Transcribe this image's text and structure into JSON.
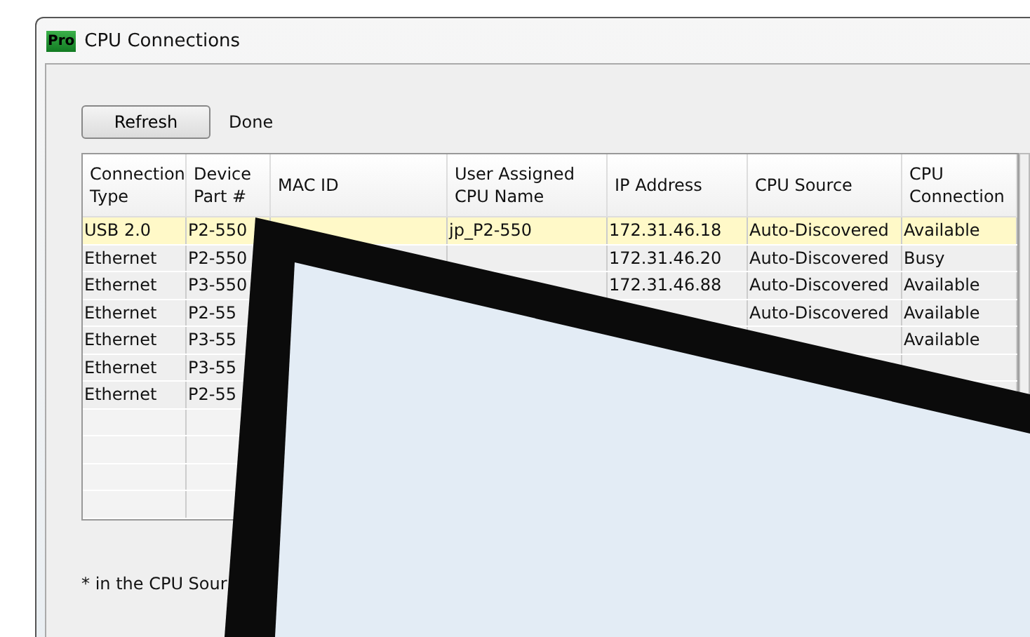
{
  "window": {
    "logo": "Pro",
    "title": "CPU Connections"
  },
  "toolbar": {
    "button": "Refresh",
    "status": "Done"
  },
  "table": {
    "columns": [
      "Connection Type",
      "Device Part #",
      "MAC ID",
      "User Assigned CPU Name",
      "IP Address",
      "CPU Source",
      "CPU Connection"
    ],
    "rows": [
      {
        "selected": true,
        "cells": [
          "USB 2.0",
          "P2-550",
          "",
          "jp_P2-550",
          "172.31.46.18",
          "Auto-Discovered",
          "Available"
        ]
      },
      {
        "selected": false,
        "cells": [
          "Ethernet",
          "P2-550",
          "",
          "",
          "172.31.46.20",
          "Auto-Discovered",
          "Busy"
        ]
      },
      {
        "selected": false,
        "cells": [
          "Ethernet",
          "P3-550",
          "",
          "",
          "172.31.46.88",
          "Auto-Discovered",
          "Available"
        ]
      },
      {
        "selected": false,
        "cells": [
          "Ethernet",
          "P2-55",
          "",
          "",
          "",
          "Auto-Discovered",
          "Available"
        ]
      },
      {
        "selected": false,
        "cells": [
          "Ethernet",
          "P3-55",
          "",
          "",
          "",
          "",
          "Available"
        ]
      },
      {
        "selected": false,
        "cells": [
          "Ethernet",
          "P3-55",
          "",
          "",
          "",
          "",
          ""
        ]
      },
      {
        "selected": false,
        "cells": [
          "Ethernet",
          "P2-55",
          "",
          "",
          "",
          "",
          ""
        ]
      }
    ]
  },
  "footnote": "* in the CPU Sour"
}
